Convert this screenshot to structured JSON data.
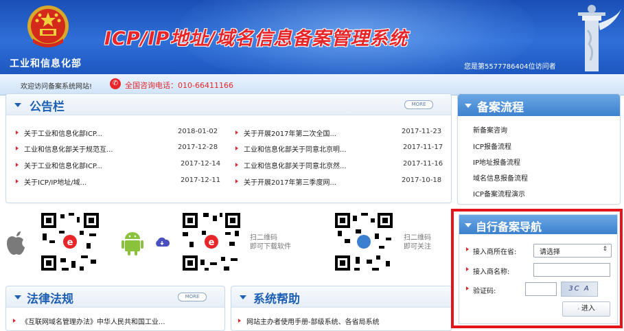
{
  "header": {
    "ministry_name": "工业和信息化部",
    "system_title": "ICP/IP地址/域名信息备案管理系统",
    "visitor_count": "您是第5577786404位访问者",
    "title_color": "#e8262a",
    "background_color": "#2f6fd8"
  },
  "infobar": {
    "welcome": "欢迎访问备案系统网站!",
    "hotline": "全国咨询电话：010-66411166",
    "phone_icon": "phone-icon"
  },
  "announcements": {
    "title": "公告栏",
    "more": "MORE",
    "left": [
      {
        "title": "关于工业和信息化部ICP...",
        "date": "2018-01-02"
      },
      {
        "title": "工业和信息化部关于规范互...",
        "date": "2017-12-28"
      },
      {
        "title": "关于工业和信息化部ICP...",
        "date": "2017-12-14"
      },
      {
        "title": "关于ICP/IP地址/域...",
        "date": "2017-12-11"
      }
    ],
    "right": [
      {
        "title": "关于开展2017年第二次全国...",
        "date": "2017-11-23"
      },
      {
        "title": "工业和信息化部关于同意北京明...",
        "date": "2017-11-17"
      },
      {
        "title": "工业和信息化部关于同意北京然...",
        "date": "2017-11-16"
      },
      {
        "title": "关于开展2017年第三季度网...",
        "date": "2017-10-18"
      }
    ]
  },
  "qr": {
    "download_text1": "扫二维码",
    "download_text2": "即可下载软件",
    "follow_text1": "扫二维码",
    "follow_text2": "即可关注"
  },
  "laws": {
    "title": "法律法规",
    "more": "MORE",
    "items": [
      "《互联网域名管理办法》中华人民共和国工业..."
    ]
  },
  "help": {
    "title": "系统帮助",
    "items": [
      "网站主办者使用手册-部级系统、各省局系统"
    ]
  },
  "flow": {
    "title": "备案流程",
    "items": [
      "新备案咨询",
      "ICP报备流程",
      "IP地址报备流程",
      "域名信息报备流程",
      "ICP备案流程演示"
    ]
  },
  "nav": {
    "title": "自行备案导航",
    "province_label": "接入商所在省:",
    "province_value": "请选择",
    "isp_label": "接入商名称:",
    "captcha_label": "验证码:",
    "captcha_text": "3C A",
    "enter_button": "进入",
    "highlight_color": "#e3141c"
  }
}
